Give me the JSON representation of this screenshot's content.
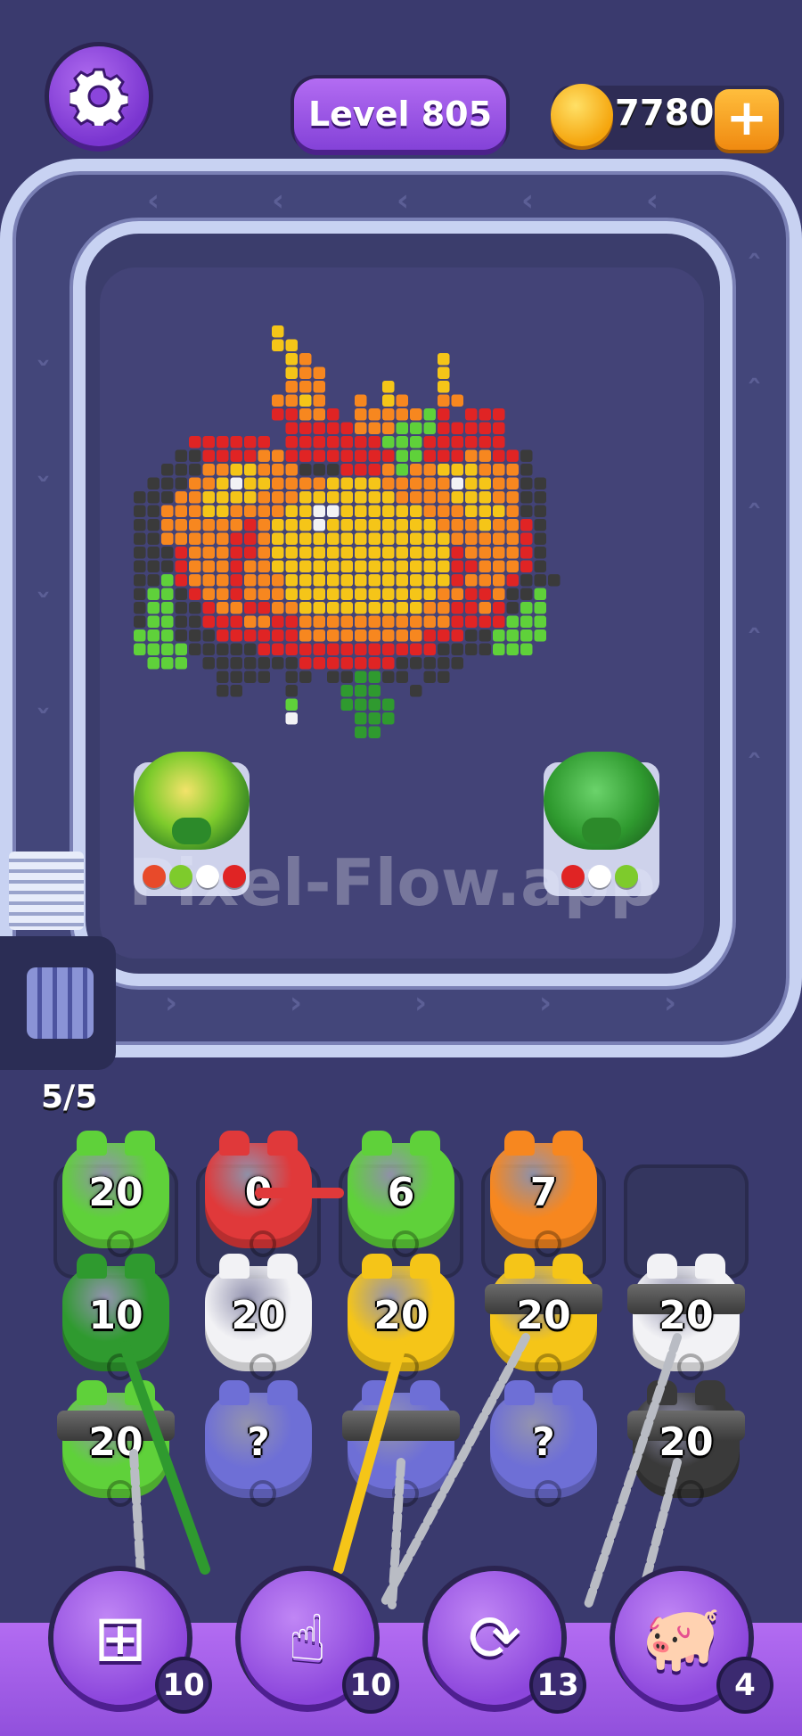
{
  "header": {
    "level_label": "Level 805",
    "coins": "7780",
    "coin_plus": "+"
  },
  "board": {
    "watermark": "Pixel-Flow.app",
    "queue_counter": "5/5"
  },
  "belt_pigs": [
    {
      "color": "#7ecb2c",
      "style": "pumpkin-lit",
      "ammo": [
        "#e84a2a",
        "#7ecb2c",
        "#ffffff",
        "#e02424"
      ]
    },
    {
      "color": "#2f9a2f",
      "style": "pumpkin",
      "ammo": [
        "#e02424",
        "#ffffff",
        "#7ecb2c"
      ]
    }
  ],
  "grid": {
    "rows": [
      [
        {
          "color": "#5fd13a",
          "count": "20"
        },
        {
          "color": "#e0393a",
          "count": "0"
        },
        {
          "color": "#5fd13a",
          "count": "6"
        },
        {
          "color": "#f7871f",
          "count": "7"
        },
        {
          "color": "",
          "count": ""
        }
      ],
      [
        {
          "color": "#2f9a2f",
          "count": "10"
        },
        {
          "color": "#f2f2f5",
          "count": "20"
        },
        {
          "color": "#f5c518",
          "count": "20"
        },
        {
          "color": "#f5c518",
          "count": "20",
          "chained": true
        },
        {
          "color": "#f2f2f5",
          "count": "20",
          "chained": true
        }
      ],
      [
        {
          "color": "#5fd13a",
          "count": "20",
          "chained": true
        },
        {
          "color": "#6e6fd6",
          "count": "?",
          "mystery": true
        },
        {
          "color": "#6e6fd6",
          "count": "",
          "chained": true
        },
        {
          "color": "#6e6fd6",
          "count": "?",
          "mystery": true
        },
        {
          "color": "#3a3a3a",
          "count": "20",
          "chained": true
        }
      ]
    ]
  },
  "tools": [
    {
      "name": "add-slot",
      "count": "10"
    },
    {
      "name": "hand",
      "count": "10"
    },
    {
      "name": "shuffle",
      "count": "13"
    },
    {
      "name": "pig",
      "count": "4"
    }
  ]
}
